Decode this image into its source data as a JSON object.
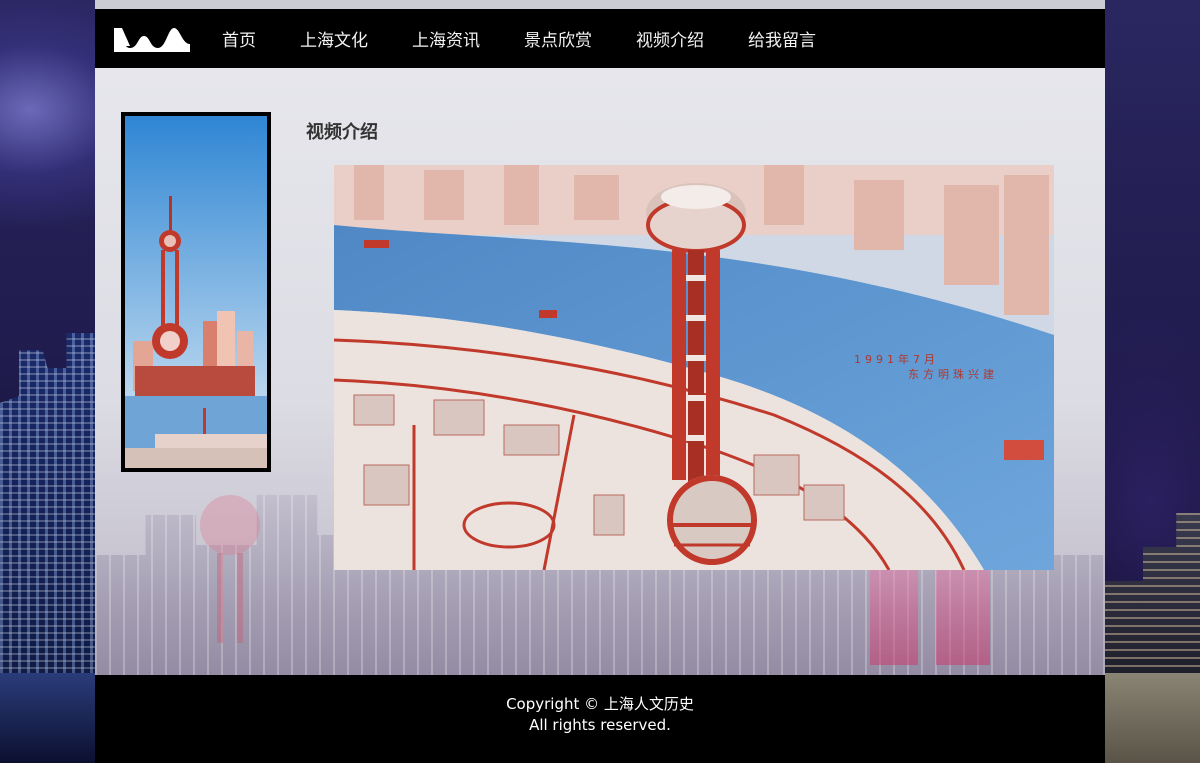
{
  "nav": {
    "logo_name": "wave-logo",
    "items": [
      "首页",
      "上海文化",
      "上海资讯",
      "景点欣赏",
      "视频介绍",
      "给我留言"
    ]
  },
  "main": {
    "title": "视频介绍",
    "video": {
      "caption_line1": "1991年7月",
      "caption_line2": "东方明珠兴建"
    }
  },
  "footer": {
    "copyright": "Copyright © 上海人文历史",
    "rights": "All rights reserved."
  },
  "colors": {
    "nav_bg": "#000000",
    "footer_bg": "#000000",
    "content_bg": "#e0e0e6",
    "accent_red": "#c0392b",
    "river_blue": "#5b8fc7"
  }
}
